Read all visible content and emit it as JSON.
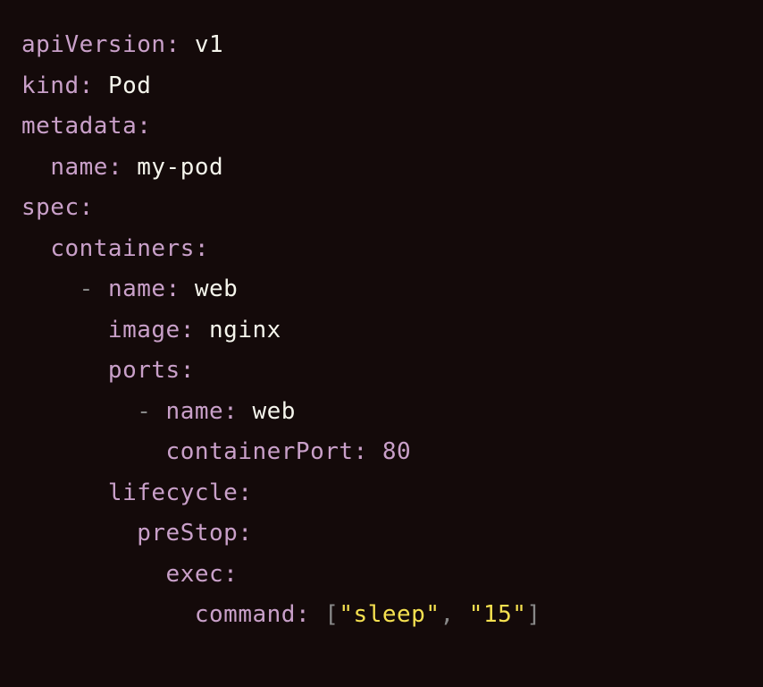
{
  "yaml": {
    "apiVersion": {
      "key": "apiVersion",
      "value": "v1"
    },
    "kind": {
      "key": "kind",
      "value": "Pod"
    },
    "metadata": {
      "key": "metadata"
    },
    "metadataName": {
      "key": "name",
      "value": "my-pod"
    },
    "spec": {
      "key": "spec"
    },
    "containers": {
      "key": "containers"
    },
    "containerName": {
      "key": "name",
      "value": "web"
    },
    "image": {
      "key": "image",
      "value": "nginx"
    },
    "ports": {
      "key": "ports"
    },
    "portName": {
      "key": "name",
      "value": "web"
    },
    "containerPort": {
      "key": "containerPort",
      "value": "80"
    },
    "lifecycle": {
      "key": "lifecycle"
    },
    "preStop": {
      "key": "preStop"
    },
    "exec": {
      "key": "exec"
    },
    "command": {
      "key": "command"
    },
    "commandValues": [
      "\"sleep\"",
      "\"15\""
    ]
  },
  "punct": {
    "colon": ":",
    "dash": "-",
    "lbracket": "[",
    "rbracket": "]",
    "comma": ",",
    "space": " ",
    "indent2": "  ",
    "indent4": "    ",
    "indent6": "      ",
    "indent8": "        ",
    "indent10": "          "
  }
}
